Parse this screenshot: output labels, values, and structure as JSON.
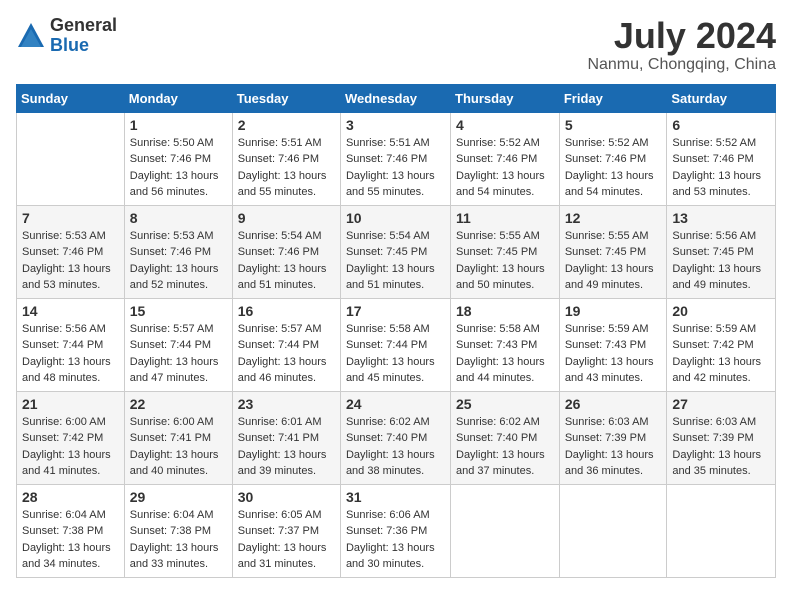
{
  "logo": {
    "general": "General",
    "blue": "Blue"
  },
  "title": {
    "month_year": "July 2024",
    "location": "Nanmu, Chongqing, China"
  },
  "days_of_week": [
    "Sunday",
    "Monday",
    "Tuesday",
    "Wednesday",
    "Thursday",
    "Friday",
    "Saturday"
  ],
  "weeks": [
    [
      {
        "day": "",
        "sunrise": "",
        "sunset": "",
        "daylight": ""
      },
      {
        "day": "1",
        "sunrise": "Sunrise: 5:50 AM",
        "sunset": "Sunset: 7:46 PM",
        "daylight": "Daylight: 13 hours and 56 minutes."
      },
      {
        "day": "2",
        "sunrise": "Sunrise: 5:51 AM",
        "sunset": "Sunset: 7:46 PM",
        "daylight": "Daylight: 13 hours and 55 minutes."
      },
      {
        "day": "3",
        "sunrise": "Sunrise: 5:51 AM",
        "sunset": "Sunset: 7:46 PM",
        "daylight": "Daylight: 13 hours and 55 minutes."
      },
      {
        "day": "4",
        "sunrise": "Sunrise: 5:52 AM",
        "sunset": "Sunset: 7:46 PM",
        "daylight": "Daylight: 13 hours and 54 minutes."
      },
      {
        "day": "5",
        "sunrise": "Sunrise: 5:52 AM",
        "sunset": "Sunset: 7:46 PM",
        "daylight": "Daylight: 13 hours and 54 minutes."
      },
      {
        "day": "6",
        "sunrise": "Sunrise: 5:52 AM",
        "sunset": "Sunset: 7:46 PM",
        "daylight": "Daylight: 13 hours and 53 minutes."
      }
    ],
    [
      {
        "day": "7",
        "sunrise": "Sunrise: 5:53 AM",
        "sunset": "Sunset: 7:46 PM",
        "daylight": "Daylight: 13 hours and 53 minutes."
      },
      {
        "day": "8",
        "sunrise": "Sunrise: 5:53 AM",
        "sunset": "Sunset: 7:46 PM",
        "daylight": "Daylight: 13 hours and 52 minutes."
      },
      {
        "day": "9",
        "sunrise": "Sunrise: 5:54 AM",
        "sunset": "Sunset: 7:46 PM",
        "daylight": "Daylight: 13 hours and 51 minutes."
      },
      {
        "day": "10",
        "sunrise": "Sunrise: 5:54 AM",
        "sunset": "Sunset: 7:45 PM",
        "daylight": "Daylight: 13 hours and 51 minutes."
      },
      {
        "day": "11",
        "sunrise": "Sunrise: 5:55 AM",
        "sunset": "Sunset: 7:45 PM",
        "daylight": "Daylight: 13 hours and 50 minutes."
      },
      {
        "day": "12",
        "sunrise": "Sunrise: 5:55 AM",
        "sunset": "Sunset: 7:45 PM",
        "daylight": "Daylight: 13 hours and 49 minutes."
      },
      {
        "day": "13",
        "sunrise": "Sunrise: 5:56 AM",
        "sunset": "Sunset: 7:45 PM",
        "daylight": "Daylight: 13 hours and 49 minutes."
      }
    ],
    [
      {
        "day": "14",
        "sunrise": "Sunrise: 5:56 AM",
        "sunset": "Sunset: 7:44 PM",
        "daylight": "Daylight: 13 hours and 48 minutes."
      },
      {
        "day": "15",
        "sunrise": "Sunrise: 5:57 AM",
        "sunset": "Sunset: 7:44 PM",
        "daylight": "Daylight: 13 hours and 47 minutes."
      },
      {
        "day": "16",
        "sunrise": "Sunrise: 5:57 AM",
        "sunset": "Sunset: 7:44 PM",
        "daylight": "Daylight: 13 hours and 46 minutes."
      },
      {
        "day": "17",
        "sunrise": "Sunrise: 5:58 AM",
        "sunset": "Sunset: 7:44 PM",
        "daylight": "Daylight: 13 hours and 45 minutes."
      },
      {
        "day": "18",
        "sunrise": "Sunrise: 5:58 AM",
        "sunset": "Sunset: 7:43 PM",
        "daylight": "Daylight: 13 hours and 44 minutes."
      },
      {
        "day": "19",
        "sunrise": "Sunrise: 5:59 AM",
        "sunset": "Sunset: 7:43 PM",
        "daylight": "Daylight: 13 hours and 43 minutes."
      },
      {
        "day": "20",
        "sunrise": "Sunrise: 5:59 AM",
        "sunset": "Sunset: 7:42 PM",
        "daylight": "Daylight: 13 hours and 42 minutes."
      }
    ],
    [
      {
        "day": "21",
        "sunrise": "Sunrise: 6:00 AM",
        "sunset": "Sunset: 7:42 PM",
        "daylight": "Daylight: 13 hours and 41 minutes."
      },
      {
        "day": "22",
        "sunrise": "Sunrise: 6:00 AM",
        "sunset": "Sunset: 7:41 PM",
        "daylight": "Daylight: 13 hours and 40 minutes."
      },
      {
        "day": "23",
        "sunrise": "Sunrise: 6:01 AM",
        "sunset": "Sunset: 7:41 PM",
        "daylight": "Daylight: 13 hours and 39 minutes."
      },
      {
        "day": "24",
        "sunrise": "Sunrise: 6:02 AM",
        "sunset": "Sunset: 7:40 PM",
        "daylight": "Daylight: 13 hours and 38 minutes."
      },
      {
        "day": "25",
        "sunrise": "Sunrise: 6:02 AM",
        "sunset": "Sunset: 7:40 PM",
        "daylight": "Daylight: 13 hours and 37 minutes."
      },
      {
        "day": "26",
        "sunrise": "Sunrise: 6:03 AM",
        "sunset": "Sunset: 7:39 PM",
        "daylight": "Daylight: 13 hours and 36 minutes."
      },
      {
        "day": "27",
        "sunrise": "Sunrise: 6:03 AM",
        "sunset": "Sunset: 7:39 PM",
        "daylight": "Daylight: 13 hours and 35 minutes."
      }
    ],
    [
      {
        "day": "28",
        "sunrise": "Sunrise: 6:04 AM",
        "sunset": "Sunset: 7:38 PM",
        "daylight": "Daylight: 13 hours and 34 minutes."
      },
      {
        "day": "29",
        "sunrise": "Sunrise: 6:04 AM",
        "sunset": "Sunset: 7:38 PM",
        "daylight": "Daylight: 13 hours and 33 minutes."
      },
      {
        "day": "30",
        "sunrise": "Sunrise: 6:05 AM",
        "sunset": "Sunset: 7:37 PM",
        "daylight": "Daylight: 13 hours and 31 minutes."
      },
      {
        "day": "31",
        "sunrise": "Sunrise: 6:06 AM",
        "sunset": "Sunset: 7:36 PM",
        "daylight": "Daylight: 13 hours and 30 minutes."
      },
      {
        "day": "",
        "sunrise": "",
        "sunset": "",
        "daylight": ""
      },
      {
        "day": "",
        "sunrise": "",
        "sunset": "",
        "daylight": ""
      },
      {
        "day": "",
        "sunrise": "",
        "sunset": "",
        "daylight": ""
      }
    ]
  ]
}
